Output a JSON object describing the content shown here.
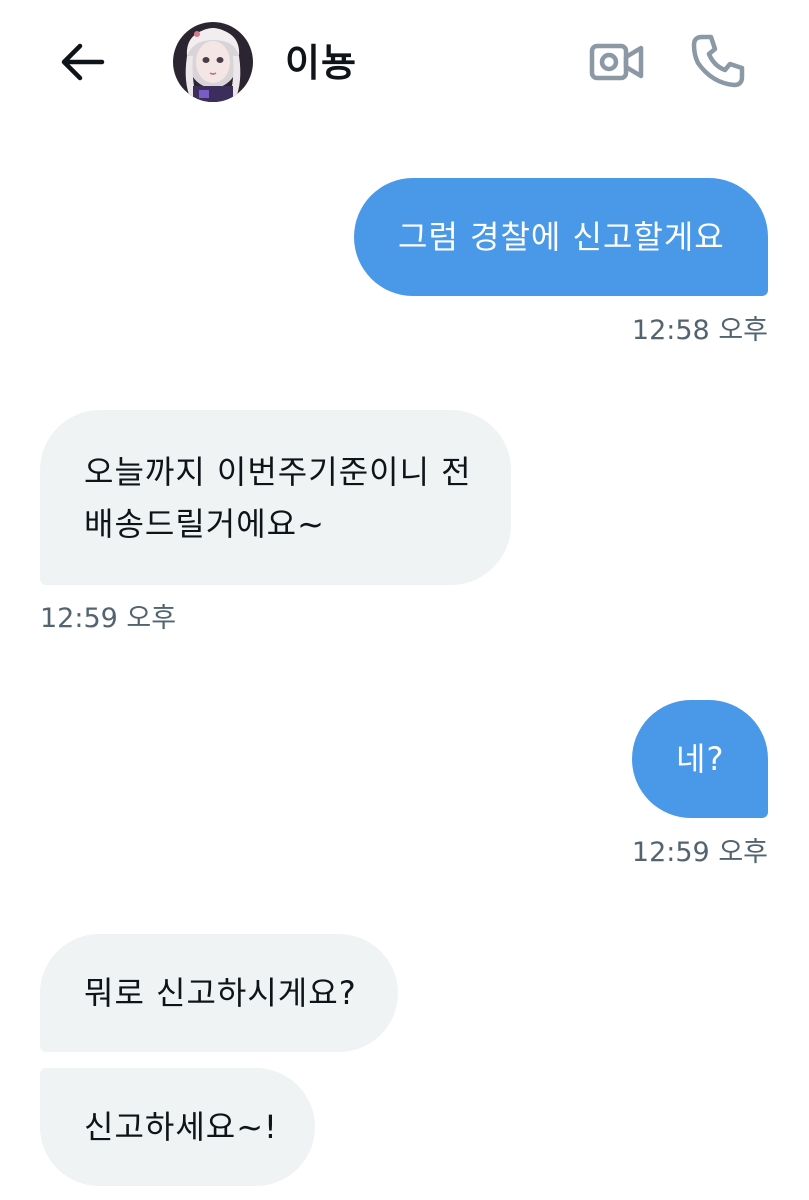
{
  "header": {
    "back_icon": "arrow-left-icon",
    "contact_name": "이뇽",
    "avatar_icon": "profile-avatar",
    "video_icon": "video-camera-icon",
    "call_icon": "phone-icon",
    "icon_color": "#8b98a5"
  },
  "colors": {
    "outgoing_bubble": "#4a99e9",
    "incoming_bubble": "#eff3f4",
    "timestamp": "#536471",
    "text": "#0f1419"
  },
  "messages": [
    {
      "direction": "outgoing",
      "text": "그럼 경찰에 신고할게요",
      "time": "12:58 오후"
    },
    {
      "direction": "incoming",
      "text": "오늘까지 이번주기준이니 전 배송드릴거에요~",
      "time": "12:59 오후"
    },
    {
      "direction": "outgoing",
      "text": "네?",
      "time": "12:59 오후"
    },
    {
      "direction": "incoming",
      "text": "뭐로 신고하시게요?",
      "time": ""
    },
    {
      "direction": "incoming",
      "text": "신고하세요~!",
      "time": ""
    }
  ]
}
